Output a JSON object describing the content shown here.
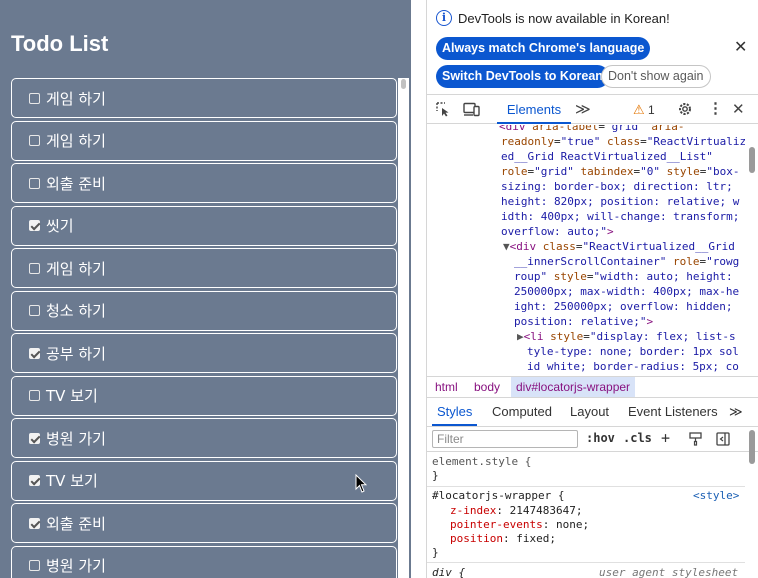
{
  "app": {
    "title": "Todo List",
    "todos": [
      {
        "label": "게임 하기",
        "done": false
      },
      {
        "label": "게임 하기",
        "done": false
      },
      {
        "label": "외출 준비",
        "done": false
      },
      {
        "label": "씻기",
        "done": true
      },
      {
        "label": "게임 하기",
        "done": false
      },
      {
        "label": "청소 하기",
        "done": false
      },
      {
        "label": "공부 하기",
        "done": true
      },
      {
        "label": "TV 보기",
        "done": false
      },
      {
        "label": "병원 가기",
        "done": true
      },
      {
        "label": "TV 보기",
        "done": true
      },
      {
        "label": "외출 준비",
        "done": true
      },
      {
        "label": "병원 가기",
        "done": false
      }
    ]
  },
  "devtools": {
    "infobar": {
      "message": "DevTools is now available in Korean!",
      "btn_match": "Always match Chrome's language",
      "btn_switch": "Switch DevTools to Korean",
      "btn_dont_show": "Don't show again"
    },
    "tabs": {
      "elements": "Elements",
      "more": "≫",
      "warnings": "1"
    },
    "breadcrumbs": [
      "html",
      "body",
      "div#locatorjs-wrapper"
    ],
    "subtabs": [
      "Styles",
      "Computed",
      "Layout",
      "Event Listeners",
      "≫"
    ],
    "filter_placeholder": "Filter",
    "hov": ":hov",
    "cls": ".cls",
    "styles": {
      "element_style": "element.style {",
      "close_brace": "}",
      "rule_selector": "#locatorjs-wrapper {",
      "rule_source": "<style>",
      "props": [
        {
          "name": "z-index",
          "value": "2147483647;"
        },
        {
          "name": "pointer-events",
          "value": "none;"
        },
        {
          "name": "position",
          "value": "fixed;"
        }
      ],
      "next_selector": "div {",
      "next_source": "user agent stylesheet"
    }
  },
  "colors": {
    "app_bg": "#6b7a90",
    "accent": "#0b57d0",
    "tag": "#881280"
  }
}
